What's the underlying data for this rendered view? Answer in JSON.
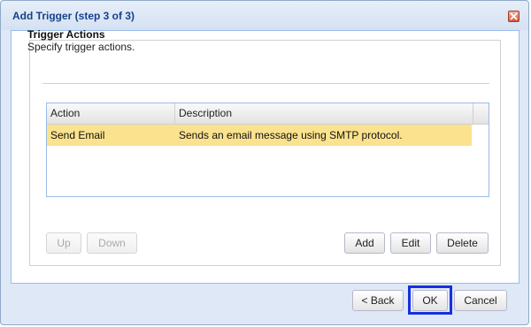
{
  "dialog": {
    "title": "Add Trigger (step 3 of 3)"
  },
  "section": {
    "title": "Trigger Actions",
    "description": "Specify trigger actions."
  },
  "grid": {
    "columns": [
      "Action",
      "Description"
    ],
    "rows": [
      {
        "action": "Send Email",
        "description": "Sends an email message using SMTP protocol.",
        "selected": true
      }
    ]
  },
  "buttons": {
    "up": "Up",
    "down": "Down",
    "add": "Add",
    "edit": "Edit",
    "delete": "Delete",
    "back": "< Back",
    "ok": "OK",
    "cancel": "Cancel"
  },
  "icons": {
    "close": "close-icon"
  },
  "colors": {
    "title_text": "#15428b",
    "selected_row": "#fbe28e",
    "ok_highlight": "#1530e0"
  }
}
